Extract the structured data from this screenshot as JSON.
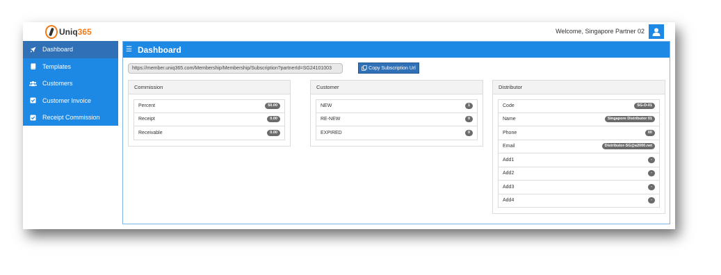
{
  "header": {
    "logo_text_a": "Uniq",
    "logo_text_b": "365",
    "welcome": "Welcome, Singapore Partner 02"
  },
  "sidebar": {
    "items": [
      {
        "label": "Dashboard",
        "icon": "rocket-icon"
      },
      {
        "label": "Templates",
        "icon": "book-icon"
      },
      {
        "label": "Customers",
        "icon": "users-icon"
      },
      {
        "label": "Customer Invoice",
        "icon": "checkbox-icon"
      },
      {
        "label": "Receipt Commission",
        "icon": "checkbox-icon"
      }
    ]
  },
  "main": {
    "title": "Dashboard",
    "url": "https://member.uniq365.com/Membership/Membership/Subscription?partnerId=SG24101003",
    "copy_label": "Copy Subscription Url"
  },
  "commission": {
    "title": "Commission",
    "rows": [
      {
        "label": "Percent",
        "value": "50.00"
      },
      {
        "label": "Receipt",
        "value": "0.00"
      },
      {
        "label": "Receivable",
        "value": "0.00"
      }
    ]
  },
  "customer": {
    "title": "Customer",
    "rows": [
      {
        "label": "NEW",
        "value": "1"
      },
      {
        "label": "RE-NEW",
        "value": "0"
      },
      {
        "label": "EXPIRED",
        "value": "0"
      }
    ]
  },
  "distributor": {
    "title": "Distributor",
    "rows": [
      {
        "label": "Code",
        "value": "SG-D-01"
      },
      {
        "label": "Name",
        "value": "Singapore Distributor 01"
      },
      {
        "label": "Phone",
        "value": "00"
      },
      {
        "label": "Email",
        "value": "Distributor-SG@a2000.net"
      },
      {
        "label": "Add1",
        "value": "-"
      },
      {
        "label": "Add2",
        "value": "-"
      },
      {
        "label": "Add3",
        "value": "-"
      },
      {
        "label": "Add4",
        "value": "-"
      }
    ]
  },
  "colors": {
    "primary": "#1e88e5",
    "active": "#2f70b7",
    "brand_orange": "#f07a1a"
  }
}
